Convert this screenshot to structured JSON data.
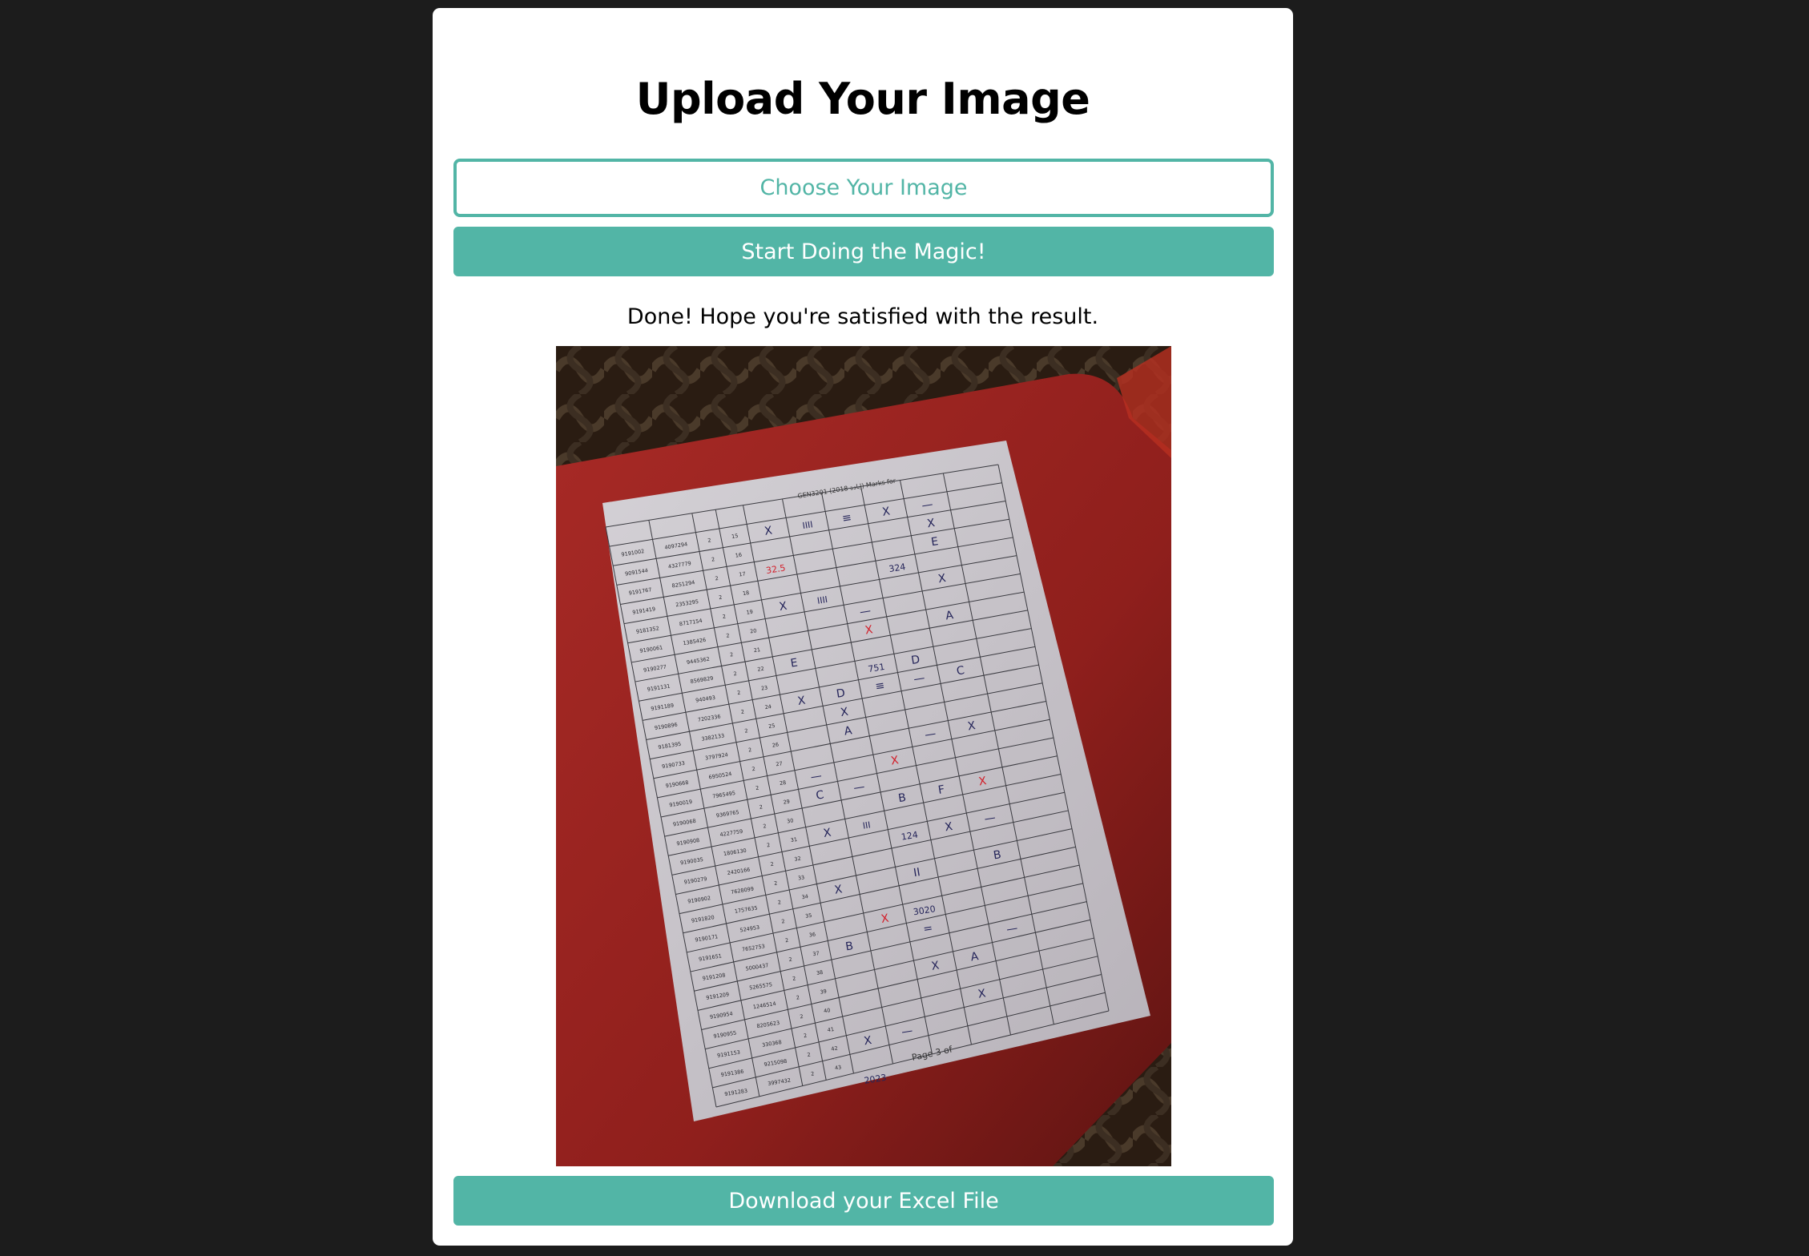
{
  "page": {
    "title": "Upload Your Image",
    "choose_button_label": "Choose Your Image",
    "magic_button_label": "Start Doing the Magic!",
    "status_message": "Done! Hope you're satisfied with the result.",
    "download_button_label": "Download your Excel File"
  },
  "colors": {
    "background": "#1c1c1c",
    "card": "#ffffff",
    "accent": "#52b5a6",
    "text": "#000000"
  },
  "result_image": {
    "header_text": "GEN3201 (2018 إبادة) Marks for",
    "footer_text": "Page 3 of",
    "rows": [
      {
        "id": "9191002",
        "code": "4097294",
        "n": "2",
        "seq": "15"
      },
      {
        "id": "9091544",
        "code": "4327779",
        "n": "2",
        "seq": "16"
      },
      {
        "id": "9191767",
        "code": "8251294",
        "n": "2",
        "seq": "17"
      },
      {
        "id": "9191419",
        "code": "2353295",
        "n": "2",
        "seq": "18"
      },
      {
        "id": "9181352",
        "code": "8717154",
        "n": "2",
        "seq": "19"
      },
      {
        "id": "9190061",
        "code": "1385426",
        "n": "2",
        "seq": "20"
      },
      {
        "id": "9190277",
        "code": "9445362",
        "n": "2",
        "seq": "21"
      },
      {
        "id": "9191131",
        "code": "8569829",
        "n": "2",
        "seq": "22"
      },
      {
        "id": "9191189",
        "code": "940493",
        "n": "2",
        "seq": "23"
      },
      {
        "id": "9190896",
        "code": "7202336",
        "n": "2",
        "seq": "24"
      },
      {
        "id": "9181395",
        "code": "3382133",
        "n": "2",
        "seq": "25"
      },
      {
        "id": "9190733",
        "code": "3797924",
        "n": "2",
        "seq": "26"
      },
      {
        "id": "9190668",
        "code": "6950524",
        "n": "2",
        "seq": "27"
      },
      {
        "id": "9190019",
        "code": "7965495",
        "n": "2",
        "seq": "28"
      },
      {
        "id": "9190068",
        "code": "9369765",
        "n": "2",
        "seq": "29"
      },
      {
        "id": "9190908",
        "code": "4227759",
        "n": "2",
        "seq": "30"
      },
      {
        "id": "9190035",
        "code": "1806130",
        "n": "2",
        "seq": "31"
      },
      {
        "id": "9190279",
        "code": "2420166",
        "n": "2",
        "seq": "32"
      },
      {
        "id": "9190902",
        "code": "7628099",
        "n": "2",
        "seq": "33"
      },
      {
        "id": "9191820",
        "code": "1757635",
        "n": "2",
        "seq": "34"
      },
      {
        "id": "9190171",
        "code": "524953",
        "n": "2",
        "seq": "35"
      },
      {
        "id": "9191651",
        "code": "7652753",
        "n": "2",
        "seq": "36"
      },
      {
        "id": "9191208",
        "code": "5000437",
        "n": "2",
        "seq": "37"
      },
      {
        "id": "9191209",
        "code": "5265575",
        "n": "2",
        "seq": "38"
      },
      {
        "id": "9190954",
        "code": "1246514",
        "n": "2",
        "seq": "39"
      },
      {
        "id": "9190955",
        "code": "8205623",
        "n": "2",
        "seq": "40"
      },
      {
        "id": "9191153",
        "code": "330368",
        "n": "2",
        "seq": "41"
      },
      {
        "id": "9191386",
        "code": "9215098",
        "n": "2",
        "seq": "42"
      },
      {
        "id": "9191283",
        "code": "3997432",
        "n": "2",
        "seq": "43"
      }
    ],
    "marks": [
      {
        "row": 0,
        "col": 4,
        "text": "X"
      },
      {
        "row": 0,
        "col": 5,
        "text": "IIII"
      },
      {
        "row": 0,
        "col": 6,
        "text": "≡"
      },
      {
        "row": 0,
        "col": 7,
        "text": "X"
      },
      {
        "row": 0,
        "col": 8,
        "text": "—"
      },
      {
        "row": 1,
        "col": 8,
        "text": "X"
      },
      {
        "row": 2,
        "col": 4,
        "text": "32.5",
        "red": true
      },
      {
        "row": 2,
        "col": 8,
        "text": "E"
      },
      {
        "row": 3,
        "col": 7,
        "text": "324"
      },
      {
        "row": 4,
        "col": 4,
        "text": "X"
      },
      {
        "row": 4,
        "col": 5,
        "text": "IIII"
      },
      {
        "row": 4,
        "col": 8,
        "text": "X"
      },
      {
        "row": 5,
        "col": 6,
        "text": "—"
      },
      {
        "row": 6,
        "col": 6,
        "text": "X",
        "red": true
      },
      {
        "row": 6,
        "col": 8,
        "text": "A"
      },
      {
        "row": 7,
        "col": 4,
        "text": "E"
      },
      {
        "row": 8,
        "col": 6,
        "text": "751"
      },
      {
        "row": 8,
        "col": 7,
        "text": "D"
      },
      {
        "row": 9,
        "col": 4,
        "text": "X"
      },
      {
        "row": 9,
        "col": 5,
        "text": "D"
      },
      {
        "row": 9,
        "col": 6,
        "text": "≡"
      },
      {
        "row": 9,
        "col": 7,
        "text": "—"
      },
      {
        "row": 9,
        "col": 8,
        "text": "C"
      },
      {
        "row": 10,
        "col": 5,
        "text": "X"
      },
      {
        "row": 11,
        "col": 5,
        "text": "A"
      },
      {
        "row": 12,
        "col": 7,
        "text": "—"
      },
      {
        "row": 12,
        "col": 8,
        "text": "X"
      },
      {
        "row": 13,
        "col": 4,
        "text": "—"
      },
      {
        "row": 13,
        "col": 6,
        "text": "X",
        "red": true
      },
      {
        "row": 14,
        "col": 4,
        "text": "C"
      },
      {
        "row": 14,
        "col": 5,
        "text": "—"
      },
      {
        "row": 15,
        "col": 6,
        "text": "B"
      },
      {
        "row": 15,
        "col": 7,
        "text": "F"
      },
      {
        "row": 15,
        "col": 8,
        "text": "X",
        "red": true
      },
      {
        "row": 16,
        "col": 4,
        "text": "X"
      },
      {
        "row": 16,
        "col": 5,
        "text": "III"
      },
      {
        "row": 17,
        "col": 6,
        "text": "124"
      },
      {
        "row": 17,
        "col": 7,
        "text": "X"
      },
      {
        "row": 17,
        "col": 8,
        "text": "—"
      },
      {
        "row": 19,
        "col": 4,
        "text": "X"
      },
      {
        "row": 19,
        "col": 6,
        "text": "II"
      },
      {
        "row": 19,
        "col": 8,
        "text": "B"
      },
      {
        "row": 21,
        "col": 5,
        "text": "X",
        "red": true
      },
      {
        "row": 21,
        "col": 6,
        "text": "3020"
      },
      {
        "row": 22,
        "col": 6,
        "text": "="
      },
      {
        "row": 22,
        "col": 4,
        "text": "B"
      },
      {
        "row": 23,
        "col": 8,
        "text": "—"
      },
      {
        "row": 24,
        "col": 6,
        "text": "X"
      },
      {
        "row": 24,
        "col": 7,
        "text": "A"
      },
      {
        "row": 26,
        "col": 7,
        "text": "X"
      },
      {
        "row": 27,
        "col": 4,
        "text": "X"
      },
      {
        "row": 27,
        "col": 5,
        "text": "—"
      },
      {
        "row": 29,
        "col": 4,
        "text": "2023"
      }
    ]
  }
}
